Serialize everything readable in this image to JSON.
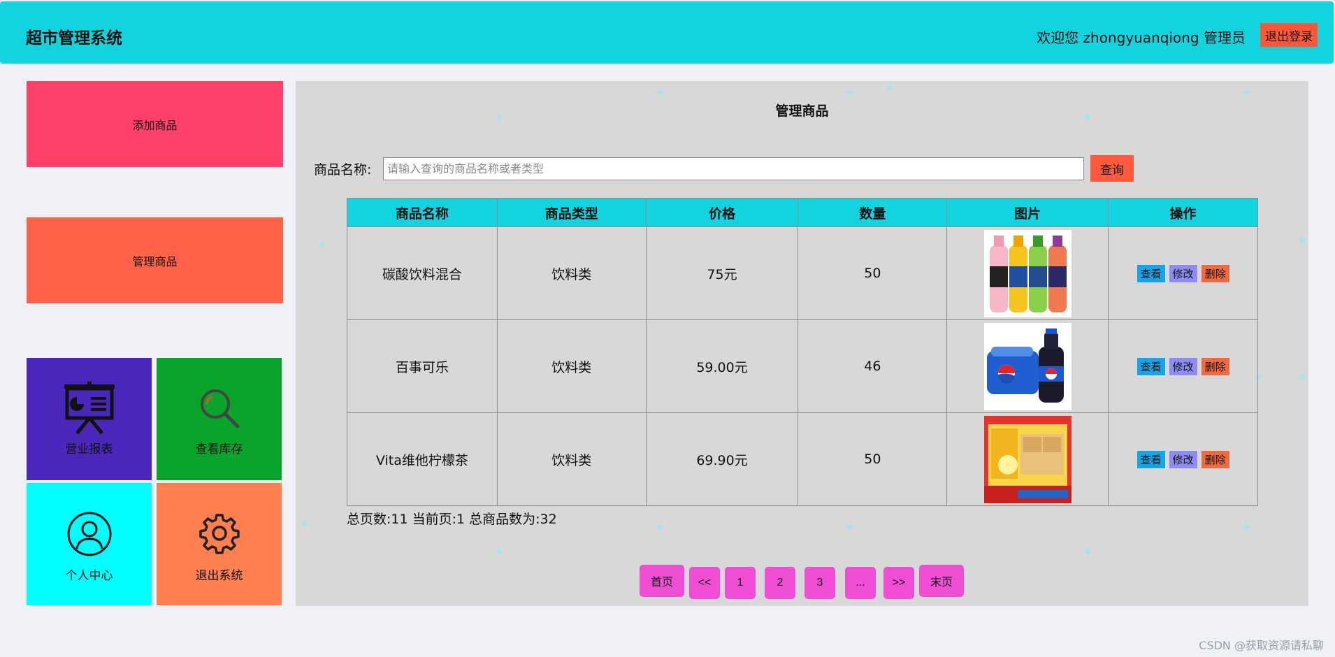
{
  "header": {
    "title": "超市管理系统",
    "welcome": "欢迎您 zhongyuanqiong 管理员",
    "logout_label": "退出登录"
  },
  "sidebar": {
    "add_label": "添加商品",
    "manage_label": "管理商品",
    "tiles": [
      {
        "label": "营业报表",
        "icon": "presentation-chart-icon"
      },
      {
        "label": "查看库存",
        "icon": "magnifier-icon"
      },
      {
        "label": "个人中心",
        "icon": "user-icon"
      },
      {
        "label": "退出系统",
        "icon": "gear-icon"
      }
    ]
  },
  "main": {
    "title": "管理商品",
    "search": {
      "label": "商品名称:",
      "placeholder": "请输入查询的商品名称或者类型",
      "button": "查询"
    },
    "table": {
      "headers": [
        "商品名称",
        "商品类型",
        "价格",
        "数量",
        "图片",
        "操作"
      ],
      "rows": [
        {
          "name": "碳酸饮料混合",
          "type": "饮料类",
          "price": "75元",
          "qty": "50",
          "image": "juice-bottles-image"
        },
        {
          "name": "百事可乐",
          "type": "饮料类",
          "price": "59.00元",
          "qty": "46",
          "image": "pepsi-pack-image"
        },
        {
          "name": "Vita维他柠檬茶",
          "type": "饮料类",
          "price": "69.90元",
          "qty": "50",
          "image": "vita-lemon-tea-image"
        }
      ],
      "actions": {
        "view": "查看",
        "edit": "修改",
        "delete": "删除"
      }
    },
    "summary": "总页数:11 当前页:1 总商品数为:32",
    "pager": {
      "first": "首页",
      "prev": "<<",
      "p1": "1",
      "p2": "2",
      "p3": "3",
      "ellipsis": "...",
      "next": ">>",
      "last": "末页"
    }
  },
  "watermark": "CSDN @获取资源请私聊",
  "colors": {
    "header": "#12d3de",
    "add_block": "#ff406a",
    "manage_block": "#ff6347",
    "report_tile": "#4a27ba",
    "stock_tile": "#09a42a",
    "user_tile": "#00ffff",
    "exit_tile": "#fe7f4f",
    "pager": "#ef4dd3"
  }
}
